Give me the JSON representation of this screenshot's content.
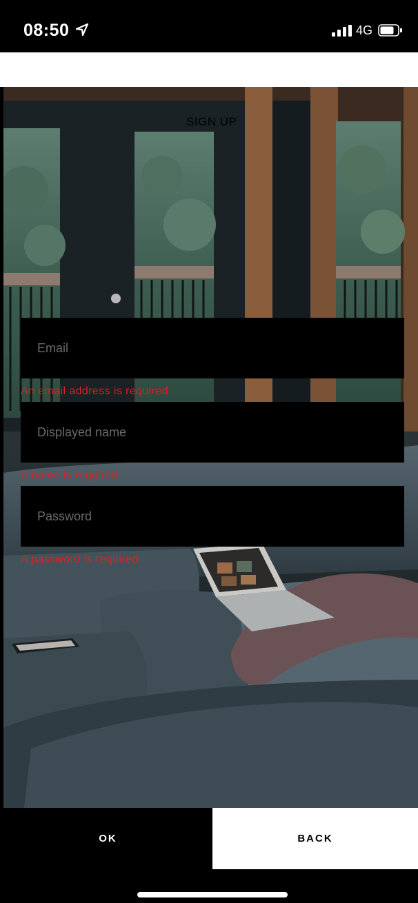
{
  "status_bar": {
    "time": "08:50",
    "network": "4G"
  },
  "page": {
    "title": "SIGN UP"
  },
  "form": {
    "email": {
      "placeholder": "Email",
      "error": "An email address is required"
    },
    "name": {
      "placeholder": "Displayed name",
      "error": "A name is required"
    },
    "password": {
      "placeholder": "Password",
      "error": "A password is required"
    }
  },
  "actions": {
    "ok_label": "OK",
    "back_label": "BACK"
  },
  "colors": {
    "error": "#e01e24",
    "field_background": "#000000",
    "background": "#000000"
  }
}
